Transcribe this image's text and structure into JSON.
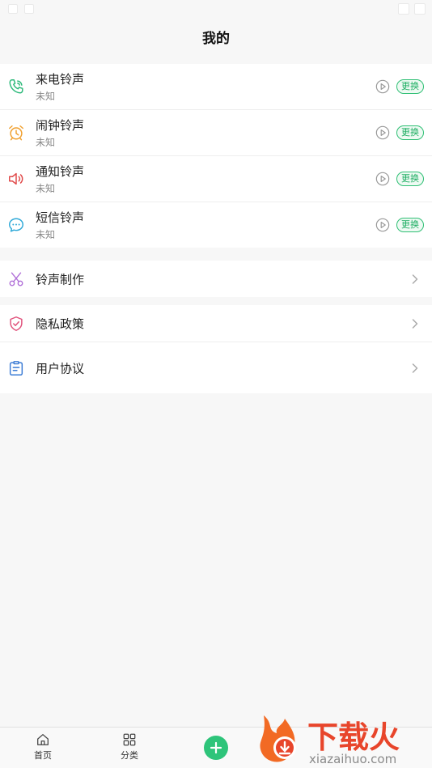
{
  "header": {
    "title": "我的"
  },
  "ringtones": [
    {
      "name": "来电铃声",
      "value": "未知",
      "icon": "phone-icon",
      "color": "#2db97a",
      "change_label": "更换"
    },
    {
      "name": "闹钟铃声",
      "value": "未知",
      "icon": "alarm-clock-icon",
      "color": "#f0a030",
      "change_label": "更换"
    },
    {
      "name": "通知铃声",
      "value": "未知",
      "icon": "speaker-icon",
      "color": "#e04848",
      "change_label": "更换"
    },
    {
      "name": "短信铃声",
      "value": "未知",
      "icon": "chat-bubble-icon",
      "color": "#2fa9d8",
      "change_label": "更换"
    }
  ],
  "tools": [
    {
      "name": "铃声制作",
      "icon": "scissors-icon",
      "color": "#b06fd8"
    }
  ],
  "legal": [
    {
      "name": "隐私政策",
      "icon": "shield-icon",
      "color": "#e0507a"
    },
    {
      "name": "用户协议",
      "icon": "document-icon",
      "color": "#3a7bd5"
    }
  ],
  "tabbar": {
    "home_label": "首页",
    "category_label": "分类",
    "accent": "#2ec47a"
  },
  "watermark": {
    "brand": "下载火",
    "site": "xiazaihuo.com"
  }
}
